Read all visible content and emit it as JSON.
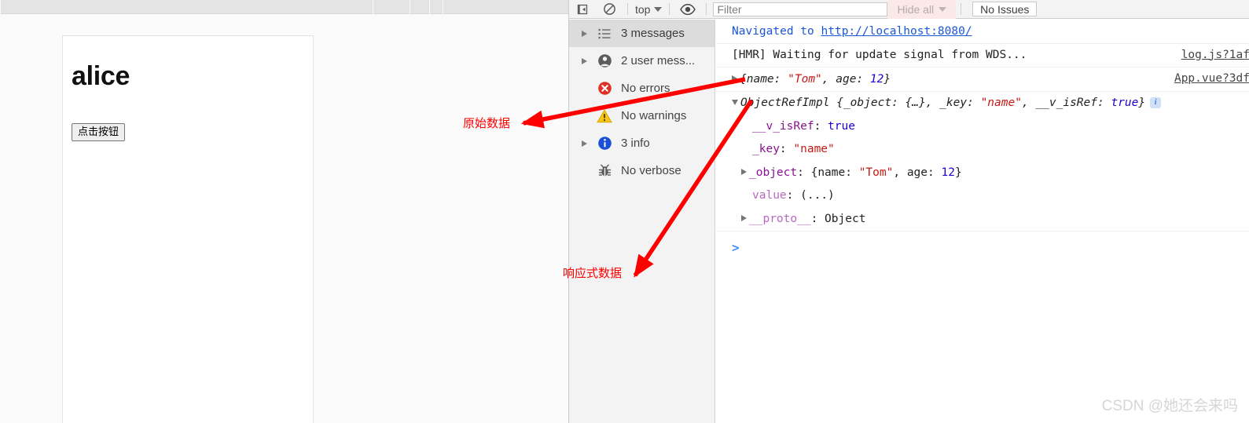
{
  "browser_chrome": {
    "tab_separators": [
      474,
      521,
      546,
      563
    ]
  },
  "web_page": {
    "heading": "alice",
    "button_label": "点击按钮"
  },
  "devtools": {
    "toolbar": {
      "clear_console_icon": "clear-console-icon",
      "no_entry_icon": "no-entry-icon",
      "context_selector_label": "top",
      "eye_icon": "eye-icon",
      "filter_placeholder": "Filter",
      "filter_value": "",
      "hide_all_label": "Hide all",
      "no_issues_label": "No Issues"
    },
    "sidebar": {
      "items": [
        {
          "label": "3 messages",
          "icon": "list-icon",
          "has_triangle": true,
          "selected": true
        },
        {
          "label": "2 user mess...",
          "icon": "person-icon",
          "has_triangle": true,
          "selected": false
        },
        {
          "label": "No errors",
          "icon": "error-icon",
          "has_triangle": false,
          "selected": false
        },
        {
          "label": "No warnings",
          "icon": "warning-icon",
          "has_triangle": false,
          "selected": false
        },
        {
          "label": "3 info",
          "icon": "info-icon",
          "has_triangle": true,
          "selected": false
        },
        {
          "label": "No verbose",
          "icon": "bug-icon",
          "has_triangle": false,
          "selected": false
        }
      ]
    },
    "log": {
      "row_navigated_prefix": "Navigated to ",
      "row_navigated_url": "http://localhost:8080/",
      "row_hmr_text": "[HMR] Waiting for update signal from WDS...",
      "row_hmr_source": "log.js?1af",
      "row_raw_object": {
        "open_brace": "{",
        "k1": "name",
        "colon1": ": ",
        "v1": "\"Tom\"",
        "comma": ", ",
        "k2": "age",
        "colon2": ": ",
        "v2": "12",
        "close_brace": "}",
        "source": "App.vue?3df"
      },
      "row_ref_header": {
        "class_name": "ObjectRefImpl ",
        "brace_open": "{",
        "p1": "_object",
        "p1v": ": {…}, ",
        "p2": "_key",
        "p2v": ": ",
        "p2s": "\"name\"",
        "comma": ", ",
        "p3": "__v_isRef",
        "p3v": ": ",
        "p3b": "true",
        "brace_close": "}"
      },
      "row_isref": {
        "key": "__v_isRef",
        "sep": ": ",
        "value": "true"
      },
      "row_key": {
        "key": "_key",
        "sep": ": ",
        "value": "\"name\""
      },
      "row_object": {
        "key": "_object",
        "sep": ": ",
        "open": "{",
        "k1": "name",
        "c1": ": ",
        "v1": "\"Tom\"",
        "comma": ", ",
        "k2": "age",
        "c2": ": ",
        "v2": "12",
        "close": "}"
      },
      "row_value": {
        "key": "value",
        "sep": ": ",
        "value": "(...)"
      },
      "row_proto": {
        "key": "__proto__",
        "sep": ": ",
        "value": "Object"
      },
      "prompt_caret": ">"
    }
  },
  "annotations": {
    "raw_data_label": "原始数据",
    "reactive_data_label": "响应式数据",
    "arrow_color": "#ff0000"
  },
  "watermark": {
    "text": "CSDN @她还会来吗"
  },
  "colors": {
    "link_blue": "#1a56d6",
    "string_red": "#c41a16",
    "number_blue": "#1c00cf",
    "property_purple": "#881391",
    "error_red": "#de3226",
    "warning_yellow": "#f5c518",
    "info_blue": "#1a73e8",
    "annotation_red": "#ff0000",
    "selected_row": "#dcdcdc"
  }
}
